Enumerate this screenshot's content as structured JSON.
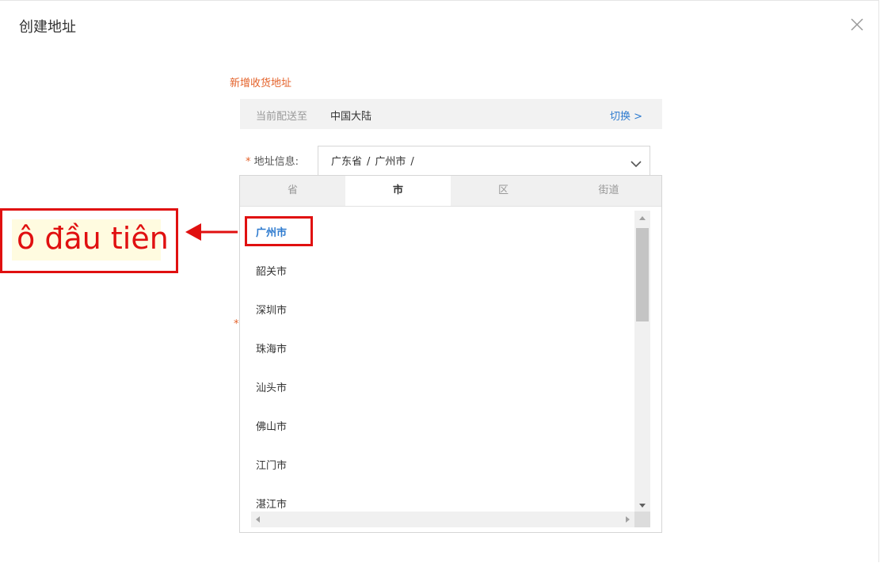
{
  "dialog": {
    "title": "创建地址"
  },
  "form": {
    "section_title": "新增收货地址",
    "shipping": {
      "label": "当前配送至",
      "value": "中国大陆",
      "switch_label": "切换 >"
    },
    "address": {
      "required_mark": "*",
      "label": "地址信息:",
      "province": "广东省",
      "separator": "/",
      "city": "广州市"
    },
    "stray_required_mark": "*"
  },
  "picker": {
    "tabs": [
      "省",
      "市",
      "区",
      "街道"
    ],
    "active_tab": "市",
    "items": [
      "广州市",
      "韶关市",
      "深圳市",
      "珠海市",
      "汕头市",
      "佛山市",
      "江门市",
      "湛江市"
    ],
    "selected_item": "广州市"
  },
  "annotation": {
    "text": "ô đầu tiên",
    "color": "#e01010"
  },
  "colors": {
    "accent_orange": "#e4622a",
    "link_blue": "#2e7bcf"
  }
}
